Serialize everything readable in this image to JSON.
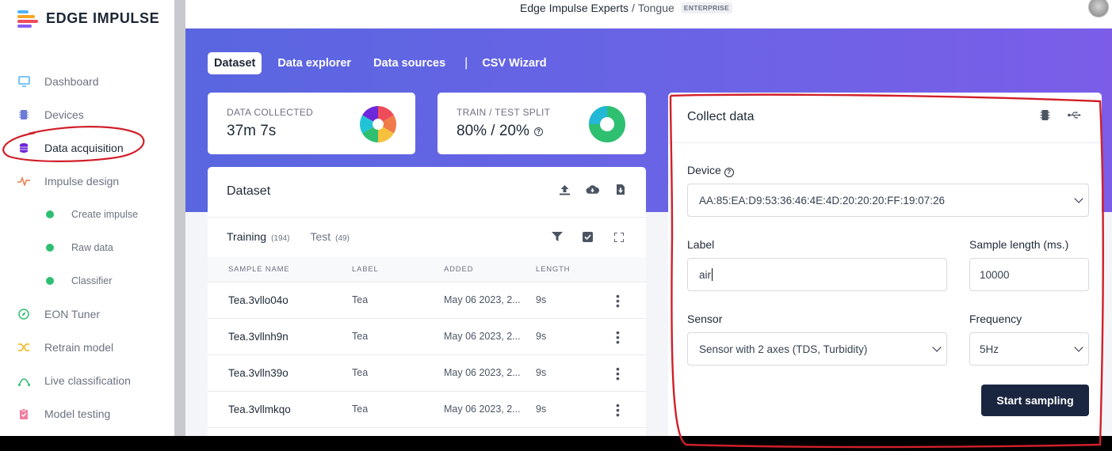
{
  "brand": {
    "name": "EDGE IMPULSE"
  },
  "colors": {
    "accent": "#5b64e3",
    "primary_button": "#1a2540",
    "green_dot": "#2fbf71",
    "annotation": "#d0202a"
  },
  "sidebar": {
    "items": [
      {
        "label": "Dashboard",
        "icon": "monitor-icon"
      },
      {
        "label": "Devices",
        "icon": "chip-icon"
      },
      {
        "label": "Data acquisition",
        "icon": "database-icon"
      },
      {
        "label": "Impulse design",
        "icon": "pulse-icon"
      },
      {
        "label": "EON Tuner",
        "icon": "compass-icon"
      },
      {
        "label": "Retrain model",
        "icon": "shuffle-icon"
      },
      {
        "label": "Live classification",
        "icon": "curve-icon"
      },
      {
        "label": "Model testing",
        "icon": "clipboard-icon"
      }
    ],
    "subitems": [
      {
        "label": "Create impulse"
      },
      {
        "label": "Raw data"
      },
      {
        "label": "Classifier"
      }
    ]
  },
  "header": {
    "org": "Edge Impulse Experts",
    "separator": "/",
    "project": "Tongue",
    "badge": "ENTERPRISE"
  },
  "tabs": [
    {
      "label": "Dataset"
    },
    {
      "label": "Data explorer"
    },
    {
      "label": "Data sources"
    },
    {
      "label": "CSV Wizard"
    }
  ],
  "tab_divider": "|",
  "stats": {
    "collected": {
      "label": "DATA COLLECTED",
      "value": "37m 7s"
    },
    "split": {
      "label": "TRAIN / TEST SPLIT",
      "value": "80% / 20%",
      "help": "?"
    }
  },
  "dataset": {
    "title": "Dataset",
    "training_label": "Training",
    "training_count": "(194)",
    "test_label": "Test",
    "test_count": "(49)",
    "columns": [
      "SAMPLE NAME",
      "LABEL",
      "ADDED",
      "LENGTH"
    ],
    "rows": [
      {
        "name": "Tea.3vllo04o",
        "label": "Tea",
        "added": "May 06 2023, 2...",
        "length": "9s"
      },
      {
        "name": "Tea.3vllnh9n",
        "label": "Tea",
        "added": "May 06 2023, 2...",
        "length": "9s"
      },
      {
        "name": "Tea.3vlln39o",
        "label": "Tea",
        "added": "May 06 2023, 2...",
        "length": "9s"
      },
      {
        "name": "Tea.3vllmkqo",
        "label": "Tea",
        "added": "May 06 2023, 2...",
        "length": "9s"
      }
    ]
  },
  "collect": {
    "title": "Collect data",
    "device_label": "Device",
    "device_value": "AA:85:EA:D9:53:36:46:4E:4D:20:20:20:FF:19:07:26",
    "label_label": "Label",
    "label_value": "air",
    "sample_length_label": "Sample length (ms.)",
    "sample_length_value": "10000",
    "sensor_label": "Sensor",
    "sensor_value": "Sensor with 2 axes (TDS, Turbidity)",
    "frequency_label": "Frequency",
    "frequency_value": "5Hz",
    "start_button": "Start sampling"
  }
}
